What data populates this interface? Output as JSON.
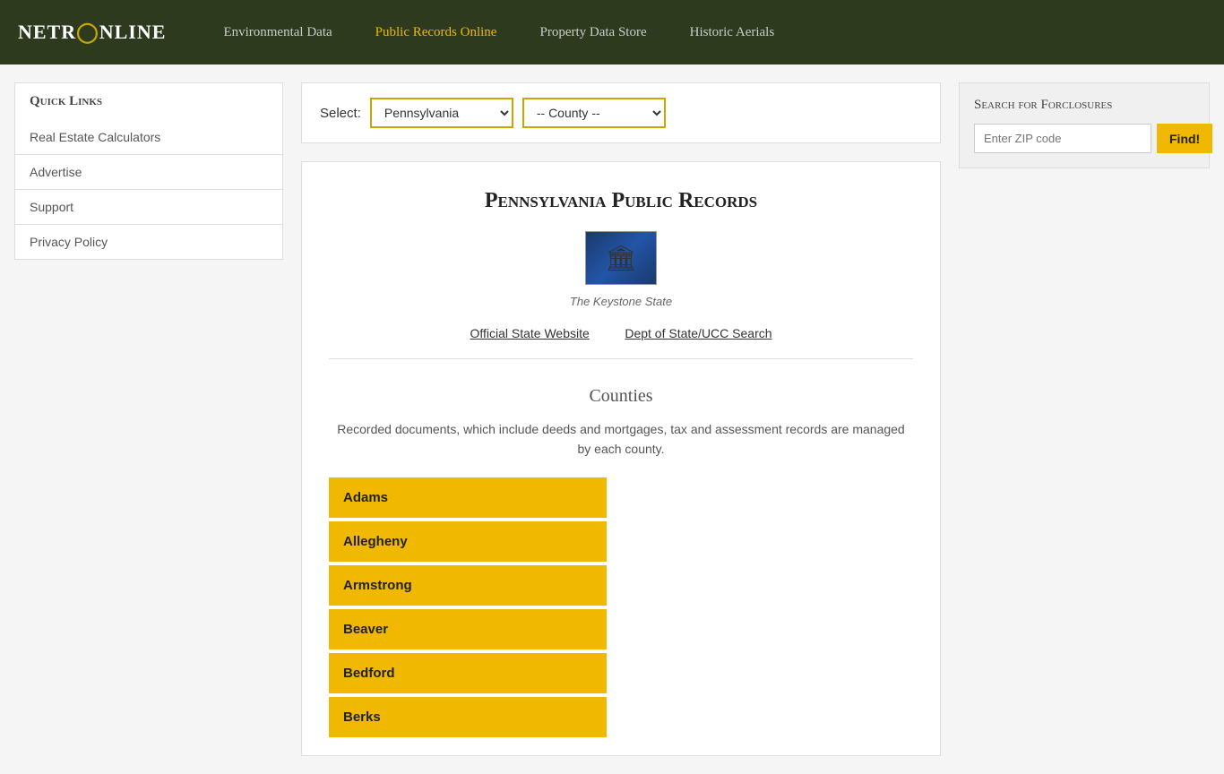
{
  "header": {
    "logo": "NETR◎NLINE",
    "nav": [
      {
        "id": "env-data",
        "label": "Environmental Data",
        "active": false
      },
      {
        "id": "public-records",
        "label": "Public Records Online",
        "active": true
      },
      {
        "id": "property-data",
        "label": "Property Data Store",
        "active": false
      },
      {
        "id": "historic-aerials",
        "label": "Historic Aerials",
        "active": false
      }
    ]
  },
  "sidebar": {
    "quick_links_label": "Quick Links",
    "items": [
      {
        "id": "real-estate-calc",
        "label": "Real Estate Calculators"
      },
      {
        "id": "advertise",
        "label": "Advertise"
      },
      {
        "id": "support",
        "label": "Support"
      },
      {
        "id": "privacy-policy",
        "label": "Privacy Policy"
      }
    ]
  },
  "select_bar": {
    "label": "Select:",
    "state_value": "Pennsylvania",
    "county_placeholder": "-- County --",
    "states": [
      "Pennsylvania"
    ],
    "counties": []
  },
  "main": {
    "page_title": "Pennsylvania Public Records",
    "state_nickname": "The Keystone State",
    "official_site_label": "Official State Website",
    "dept_search_label": "Dept of State/UCC Search",
    "counties_header": "Counties",
    "counties_description": "Recorded documents, which include deeds and mortgages, tax and assessment records are managed by each county.",
    "counties": [
      "Adams",
      "Allegheny",
      "Armstrong",
      "Beaver",
      "Bedford",
      "Berks"
    ]
  },
  "right_sidebar": {
    "foreclosure_title": "Search for Forclosures",
    "zip_placeholder": "Enter ZIP code",
    "find_button_label": "Find!"
  }
}
